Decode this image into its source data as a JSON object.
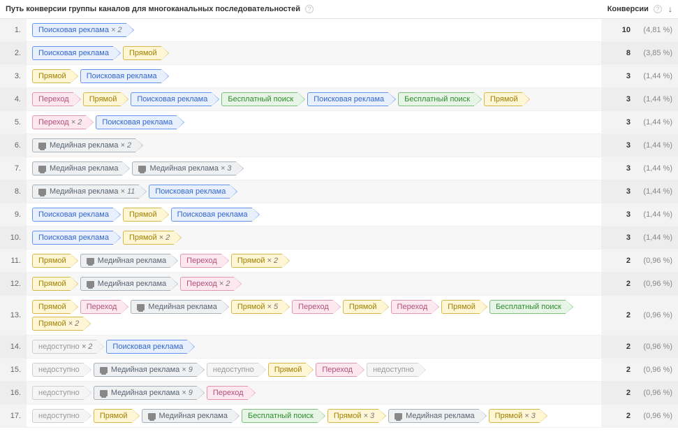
{
  "headers": {
    "path": "Путь конверсии группы каналов для многоканальных последовательностей",
    "conversions": "Конверсии"
  },
  "channelLabels": {
    "paid_search": "Поисковая реклама",
    "direct": "Прямой",
    "referral": "Переход",
    "organic": "Бесплатный поиск",
    "display": "Медийная реклама",
    "unavailable": "недоступно"
  },
  "rows": [
    {
      "idx": 1,
      "count": 10,
      "pct": "(4,81 %)",
      "path": [
        {
          "c": "paid_search",
          "x": 2
        }
      ]
    },
    {
      "idx": 2,
      "count": 8,
      "pct": "(3,85 %)",
      "path": [
        {
          "c": "paid_search"
        },
        {
          "c": "direct"
        }
      ]
    },
    {
      "idx": 3,
      "count": 3,
      "pct": "(1,44 %)",
      "path": [
        {
          "c": "direct"
        },
        {
          "c": "paid_search"
        }
      ]
    },
    {
      "idx": 4,
      "count": 3,
      "pct": "(1,44 %)",
      "path": [
        {
          "c": "referral"
        },
        {
          "c": "direct"
        },
        {
          "c": "paid_search"
        },
        {
          "c": "organic"
        },
        {
          "c": "paid_search"
        },
        {
          "c": "organic"
        },
        {
          "c": "direct"
        }
      ]
    },
    {
      "idx": 5,
      "count": 3,
      "pct": "(1,44 %)",
      "path": [
        {
          "c": "referral",
          "x": 2
        },
        {
          "c": "paid_search"
        }
      ]
    },
    {
      "idx": 6,
      "count": 3,
      "pct": "(1,44 %)",
      "path": [
        {
          "c": "display",
          "x": 2
        }
      ]
    },
    {
      "idx": 7,
      "count": 3,
      "pct": "(1,44 %)",
      "path": [
        {
          "c": "display"
        },
        {
          "c": "display",
          "x": 3
        }
      ]
    },
    {
      "idx": 8,
      "count": 3,
      "pct": "(1,44 %)",
      "path": [
        {
          "c": "display",
          "x": 11
        },
        {
          "c": "paid_search"
        }
      ]
    },
    {
      "idx": 9,
      "count": 3,
      "pct": "(1,44 %)",
      "path": [
        {
          "c": "paid_search"
        },
        {
          "c": "direct"
        },
        {
          "c": "paid_search"
        }
      ]
    },
    {
      "idx": 10,
      "count": 3,
      "pct": "(1,44 %)",
      "path": [
        {
          "c": "paid_search"
        },
        {
          "c": "direct",
          "x": 2
        }
      ]
    },
    {
      "idx": 11,
      "count": 2,
      "pct": "(0,96 %)",
      "path": [
        {
          "c": "direct"
        },
        {
          "c": "display"
        },
        {
          "c": "referral"
        },
        {
          "c": "direct",
          "x": 2
        }
      ]
    },
    {
      "idx": 12,
      "count": 2,
      "pct": "(0,96 %)",
      "path": [
        {
          "c": "direct"
        },
        {
          "c": "display"
        },
        {
          "c": "referral",
          "x": 2
        }
      ]
    },
    {
      "idx": 13,
      "count": 2,
      "pct": "(0,96 %)",
      "path": [
        {
          "c": "direct"
        },
        {
          "c": "referral"
        },
        {
          "c": "display"
        },
        {
          "c": "direct",
          "x": 5
        },
        {
          "c": "referral"
        },
        {
          "c": "direct"
        },
        {
          "c": "referral"
        },
        {
          "c": "direct"
        },
        {
          "c": "organic"
        },
        {
          "c": "direct",
          "x": 2
        }
      ]
    },
    {
      "idx": 14,
      "count": 2,
      "pct": "(0,96 %)",
      "path": [
        {
          "c": "unavailable",
          "x": 2
        },
        {
          "c": "paid_search"
        }
      ]
    },
    {
      "idx": 15,
      "count": 2,
      "pct": "(0,96 %)",
      "path": [
        {
          "c": "unavailable"
        },
        {
          "c": "display",
          "x": 9
        },
        {
          "c": "unavailable"
        },
        {
          "c": "direct"
        },
        {
          "c": "referral"
        },
        {
          "c": "unavailable"
        }
      ]
    },
    {
      "idx": 16,
      "count": 2,
      "pct": "(0,96 %)",
      "path": [
        {
          "c": "unavailable"
        },
        {
          "c": "display",
          "x": 9
        },
        {
          "c": "referral"
        }
      ]
    },
    {
      "idx": 17,
      "count": 2,
      "pct": "(0,96 %)",
      "path": [
        {
          "c": "unavailable"
        },
        {
          "c": "direct"
        },
        {
          "c": "display"
        },
        {
          "c": "organic"
        },
        {
          "c": "direct",
          "x": 3
        },
        {
          "c": "display"
        },
        {
          "c": "direct",
          "x": 3
        }
      ]
    }
  ]
}
